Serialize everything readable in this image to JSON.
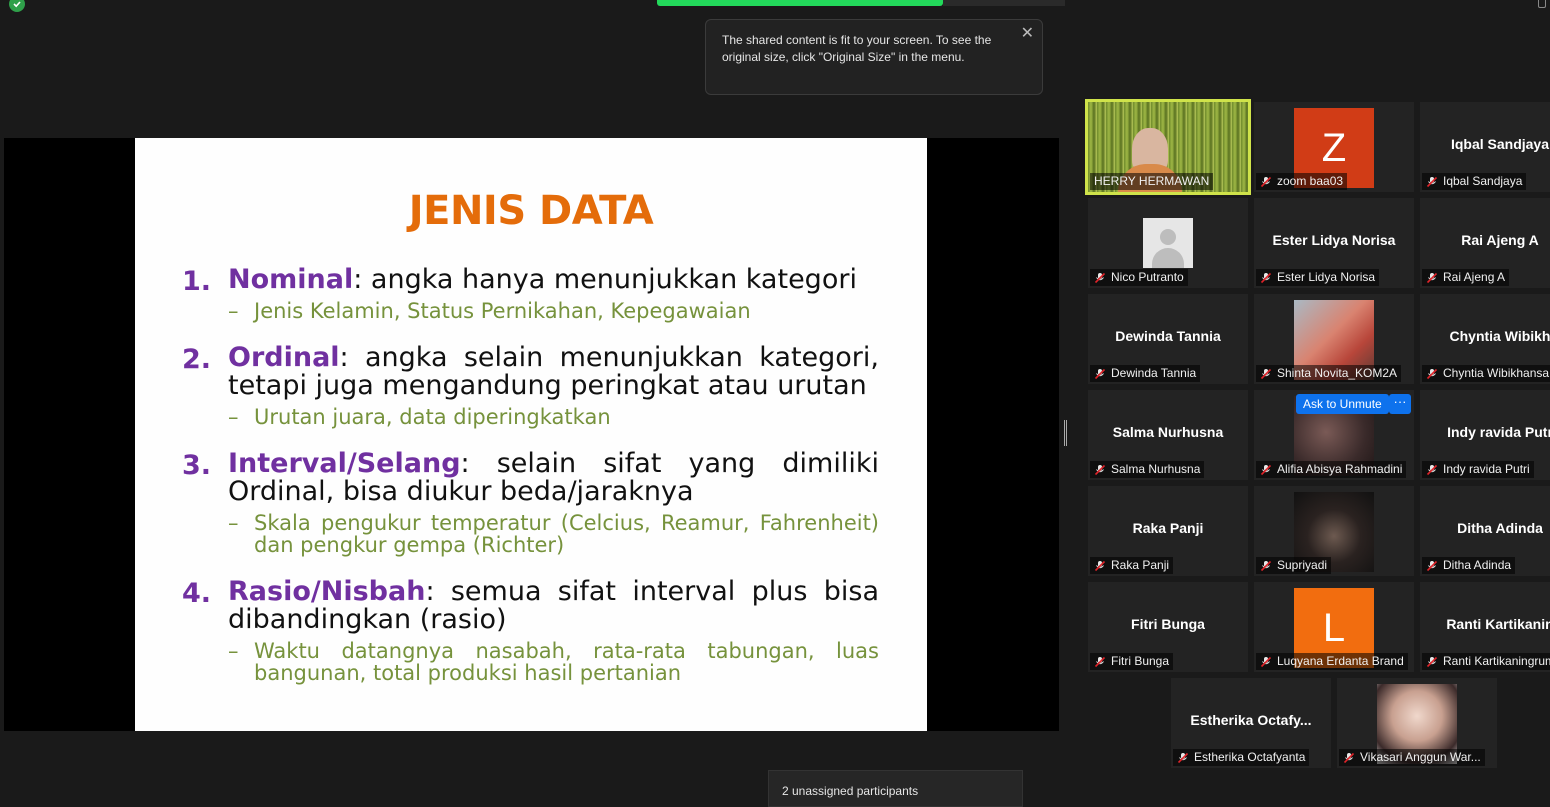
{
  "tooltip": {
    "text": "The shared content is fit to your screen. To see the original size, click \"Original Size\" in the menu.",
    "close": "✕"
  },
  "slide": {
    "title": "JENIS DATA",
    "items": [
      {
        "num": "1.",
        "term": "Nominal",
        "rest": ": angka hanya menunjukkan kategori",
        "sub": "Jenis Kelamin, Status Pernikahan, Kepegawaian"
      },
      {
        "num": "2.",
        "term": "Ordinal",
        "rest": ": angka selain menunjukkan kategori, tetapi juga mengandung peringkat atau urutan",
        "sub": "Urutan juara, data diperingkatkan"
      },
      {
        "num": "3.",
        "term": "Interval/Selang",
        "rest": ": selain sifat yang dimiliki Ordinal, bisa diukur beda/jaraknya",
        "sub": "Skala pengukur temperatur (Celcius, Reamur, Fahrenheit) dan pengkur gempa (Richter)"
      },
      {
        "num": "4.",
        "term": "Rasio/Nisbah",
        "rest": ": semua sifat interval plus bisa dibandingkan (rasio)",
        "sub": "Waktu datangnya nasabah, rata-rata tabungan, luas bangunan, total produksi hasil pertanian"
      }
    ]
  },
  "gallery": {
    "ask_unmute": "Ask to Unmute",
    "more": "···",
    "participants": [
      {
        "label": "HERRY HERMAWAN",
        "avatar": "video",
        "muted": false
      },
      {
        "label": "zoom baa03",
        "avatar": "letter",
        "letter": "Z",
        "color": "#d13c16",
        "muted": true
      },
      {
        "label": "Iqbal Sandjaya",
        "name": "Iqbal Sandjaya",
        "avatar": "name",
        "muted": true
      },
      {
        "label": "Nico Putranto",
        "avatar": "generic",
        "muted": true
      },
      {
        "label": "Ester Lidya Norisa",
        "name": "Ester Lidya Norisa",
        "avatar": "name",
        "muted": true
      },
      {
        "label": "Rai Ajeng A",
        "name": "Rai Ajeng A",
        "avatar": "name",
        "muted": true
      },
      {
        "label": "Dewinda Tannia",
        "name": "Dewinda Tannia",
        "avatar": "name",
        "muted": true
      },
      {
        "label": "Shinta Novita_KOM2A",
        "avatar": "photo",
        "muted": true
      },
      {
        "label": "Chyntia Wibikhansa",
        "name": "Chyntia  Wibikh",
        "avatar": "name",
        "muted": true
      },
      {
        "label": "Salma Nurhusna",
        "name": "Salma Nurhusna",
        "avatar": "name",
        "muted": true
      },
      {
        "label": "Alifia Abisya Rahmadini",
        "avatar": "photo",
        "muted": true
      },
      {
        "label": "Indy ravida Putri",
        "name": "Indy ravida Putr",
        "avatar": "name",
        "muted": true
      },
      {
        "label": "Raka Panji",
        "name": "Raka Panji",
        "avatar": "name",
        "muted": true
      },
      {
        "label": "Supriyadi",
        "avatar": "photo",
        "muted": true
      },
      {
        "label": "Ditha Adinda",
        "name": "Ditha Adinda",
        "avatar": "name",
        "muted": true
      },
      {
        "label": "Fitri Bunga",
        "name": "Fitri Bunga",
        "avatar": "name",
        "muted": true
      },
      {
        "label": "Luqyana Erdanta Brand",
        "avatar": "letter",
        "letter": "L",
        "color": "#f26d0f",
        "muted": true
      },
      {
        "label": "Ranti Kartikaningrum",
        "name": "Ranti  Kartikanin",
        "avatar": "name",
        "muted": true
      },
      {
        "label": "Estherika Octafyanta",
        "name": "Estherika  Octafy...",
        "avatar": "name",
        "muted": true
      },
      {
        "label": "Vikasari Anggun War...",
        "avatar": "photo",
        "muted": true
      }
    ]
  },
  "unassigned": "2 unassigned participants",
  "colors": {
    "active_border": "#cfe34a",
    "share_bar": "#23d95b",
    "title": "#e46c0a",
    "term": "#7030a0",
    "sub": "#76923c"
  }
}
